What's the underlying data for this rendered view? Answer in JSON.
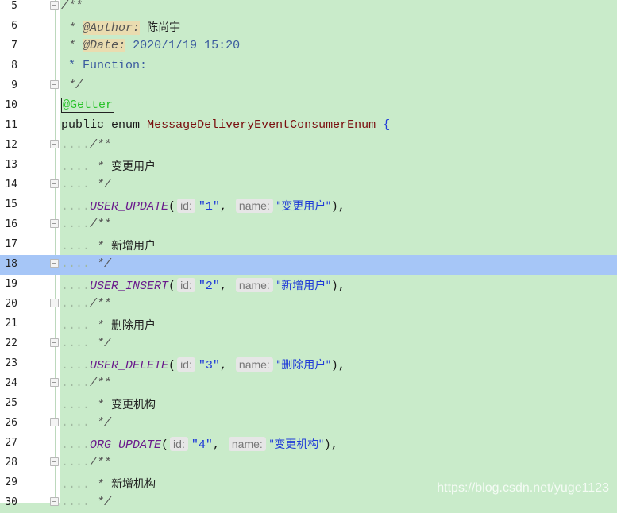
{
  "editor": {
    "lines": [
      {
        "n": "5"
      },
      {
        "n": "6"
      },
      {
        "n": "7"
      },
      {
        "n": "8"
      },
      {
        "n": "9"
      },
      {
        "n": "10"
      },
      {
        "n": "11"
      },
      {
        "n": "12"
      },
      {
        "n": "13"
      },
      {
        "n": "14"
      },
      {
        "n": "15"
      },
      {
        "n": "16"
      },
      {
        "n": "17"
      },
      {
        "n": "18"
      },
      {
        "n": "19"
      },
      {
        "n": "20"
      },
      {
        "n": "21"
      },
      {
        "n": "22"
      },
      {
        "n": "23"
      },
      {
        "n": "24"
      },
      {
        "n": "25"
      },
      {
        "n": "26"
      },
      {
        "n": "27"
      },
      {
        "n": "28"
      },
      {
        "n": "29"
      },
      {
        "n": "30"
      }
    ],
    "current_line": "18",
    "header_comment": {
      "open": "/**",
      "author_tag": "@Author:",
      "author": "陈尚宇",
      "date_tag": "@Date:",
      "date": "2020/1/19 15:20",
      "function": "* Function:",
      "close": "*/",
      "star": "*"
    },
    "annotation": "@Getter",
    "decl": {
      "public": "public",
      "enum": "enum",
      "name": "MessageDeliveryEventConsumerEnum",
      "brace": "{"
    },
    "enum_entries": [
      {
        "doc": "变更用户",
        "const": "USER_UPDATE",
        "id_hint": "id:",
        "id": "\"1\"",
        "name_hint": "name:",
        "name": "\"变更用户\""
      },
      {
        "doc": "新增用户",
        "const": "USER_INSERT",
        "id_hint": "id:",
        "id": "\"2\"",
        "name_hint": "name:",
        "name": "\"新增用户\""
      },
      {
        "doc": "删除用户",
        "const": "USER_DELETE",
        "id_hint": "id:",
        "id": "\"3\"",
        "name_hint": "name:",
        "name": "\"删除用户\""
      },
      {
        "doc": "变更机构",
        "const": "ORG_UPDATE",
        "id_hint": "id:",
        "id": "\"4\"",
        "name_hint": "name:",
        "name": "\"变更机构\""
      },
      {
        "doc": "新增机构"
      }
    ],
    "doc_open": "/**",
    "doc_star": "*",
    "doc_close": "*/",
    "indent_dots": "....",
    "paren_open": "(",
    "comma": ",",
    "paren_close_comma": "),"
  },
  "watermark": "https://blog.csdn.net/yuge1123",
  "colors": {
    "background": "#c9ebca",
    "current_line": "#a6c6f7",
    "string": "#1f3bd8",
    "enum_const": "#6a1a8c"
  }
}
